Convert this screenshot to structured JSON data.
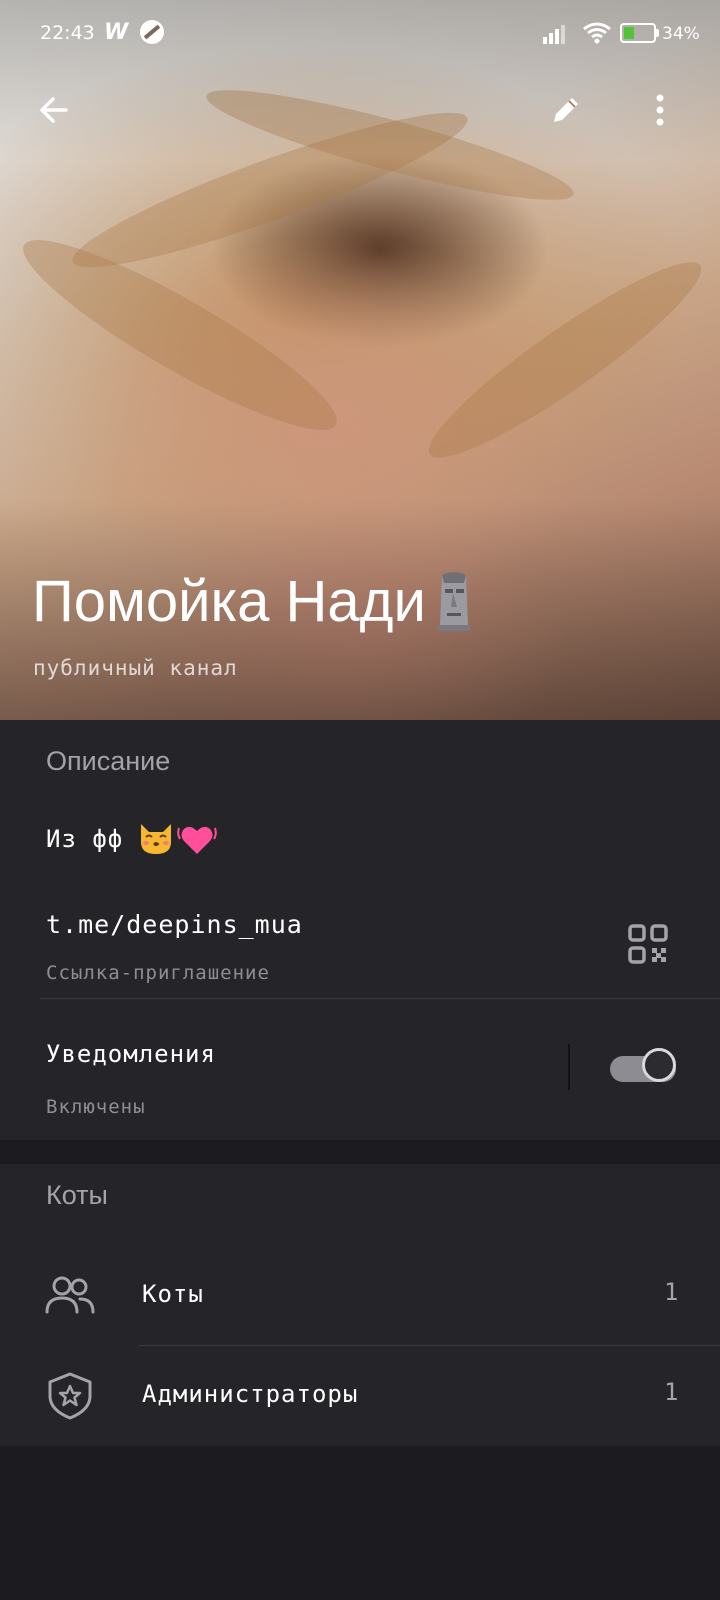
{
  "status_bar": {
    "time": "22:43",
    "app_icon_1": "W",
    "battery_percent": "34%",
    "battery_level": 0.34,
    "charging": true
  },
  "header": {
    "back_icon": "arrow-left-icon",
    "edit_icon": "pencil-icon",
    "more_icon": "more-vertical-icon",
    "title": "Помойка Нади",
    "title_emoji": "moai-emoji",
    "subtitle": "публичный канал"
  },
  "info": {
    "description_heading": "Описание",
    "description_text": "Из фф",
    "description_emojis": [
      "kissing-cat-emoji",
      "beating-heart-emoji"
    ],
    "link": "t.me/deepins_mua",
    "link_label": "Ссылка-приглашение",
    "qr_icon": "qr-code-icon",
    "notifications_title": "Уведомления",
    "notifications_status": "Включены",
    "notifications_enabled": true
  },
  "members": {
    "heading": "Коты",
    "rows": [
      {
        "label": "Коты",
        "count": "1",
        "icon": "people-icon"
      },
      {
        "label": "Администраторы",
        "count": "1",
        "icon": "shield-star-icon"
      }
    ]
  },
  "colors": {
    "background": "#1c1b1f",
    "card": "#252428",
    "section_heading": "#a4a3a9",
    "battery_fill": "#53c43a"
  }
}
